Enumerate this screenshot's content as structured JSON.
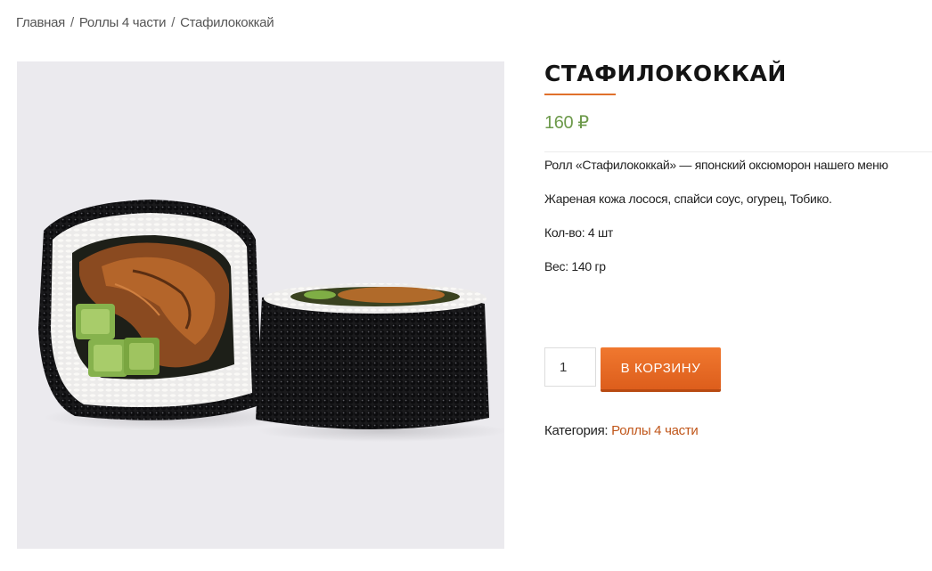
{
  "breadcrumb": {
    "items": [
      "Главная",
      "Роллы 4 части",
      "Стафилококкай"
    ],
    "separator": "/"
  },
  "product": {
    "title": "СТАФИЛОКОККАЙ",
    "price": "160 ₽",
    "description": [
      "Ролл «Стафилококкай» — японский оксюморон нашего меню",
      "Жареная кожа лосося, спайси соус, огурец, Тобико.",
      "Кол-во: 4 шт",
      "Вес: 140 гр"
    ],
    "quantity": "1",
    "add_to_cart_label": "В КОРЗИНУ",
    "category_label": "Категория:",
    "category_value": "Роллы 4 части"
  },
  "colors": {
    "accent": "#e0702c",
    "price": "#6d9a4b",
    "photo_background": "#ebeaee"
  }
}
